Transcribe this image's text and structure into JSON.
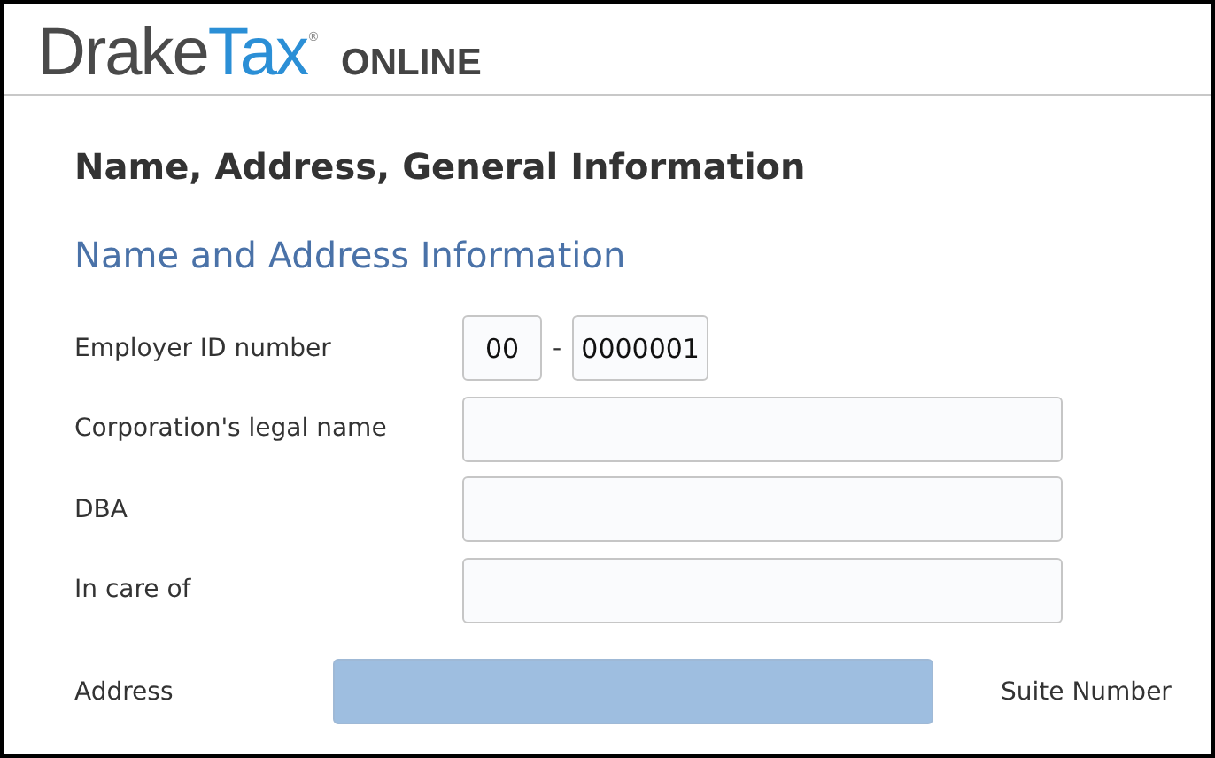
{
  "logo": {
    "first": "Drake",
    "second": "Tax",
    "mark": "®",
    "suffix": "ONLINE"
  },
  "page_title": "Name, Address, General Information",
  "section_title": "Name and Address Information",
  "ein": {
    "label": "Employer ID number",
    "prefix": "00",
    "separator": "-",
    "suffix": "0000001"
  },
  "fields": [
    {
      "label": "Corporation's legal name"
    },
    {
      "label": "DBA"
    },
    {
      "label": "In care of"
    }
  ],
  "address": {
    "label": "Address",
    "focused": true,
    "suite_label": "Suite Number"
  }
}
